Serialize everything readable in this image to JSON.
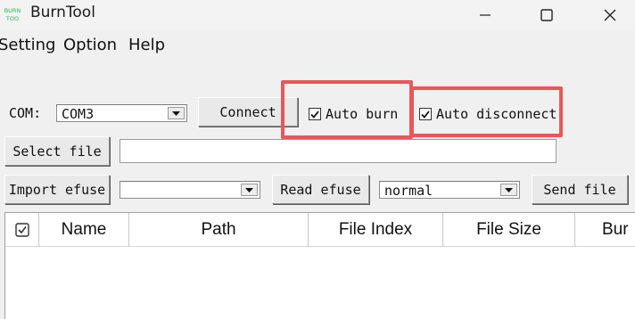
{
  "window": {
    "title": "BurnTool",
    "icon_text": [
      "BURN",
      "TOO"
    ],
    "icon": "burntool-app-icon",
    "controls": [
      "minimize-icon",
      "maximize-icon",
      "close-icon"
    ]
  },
  "menu": {
    "setting": "Setting",
    "option": "Option",
    "help": "Help"
  },
  "row1": {
    "com_label": "COM:",
    "com_value": "COM3",
    "connect_label": "Connect",
    "auto_burn_label": "Auto burn",
    "auto_burn_checked": true,
    "auto_disconnect_label": "Auto disconnect",
    "auto_disconnect_checked": true
  },
  "row2": {
    "select_file_label": "Select file",
    "file_path_value": ""
  },
  "row3": {
    "import_efuse_label": "Import efuse",
    "efuse_combo_value": "",
    "read_efuse_label": "Read efuse",
    "mode_value": "normal",
    "send_file_label": "Send file"
  },
  "table": {
    "columns": [
      "Name",
      "Path",
      "File Index",
      "File Size",
      "Bur"
    ],
    "header_checkbox_icon": "checkbox-checked-icon",
    "rows": []
  },
  "colors": {
    "highlight": "#e8575a",
    "window_bg": "#f0f0f0"
  }
}
